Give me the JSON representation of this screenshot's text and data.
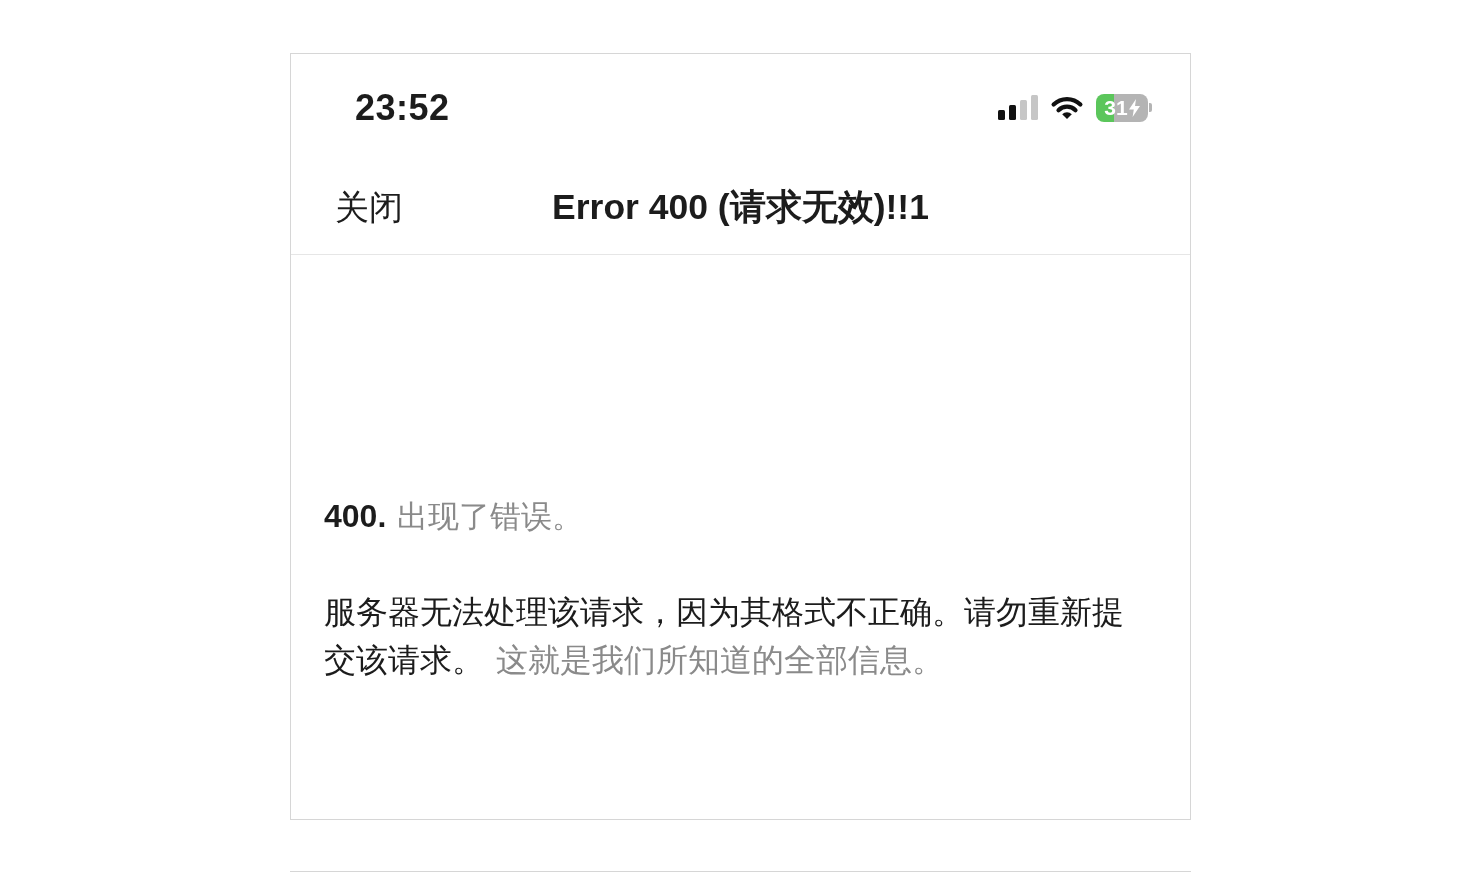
{
  "status_bar": {
    "time": "23:52",
    "battery_percent": "31",
    "charging": true
  },
  "nav_bar": {
    "close_label": "关闭",
    "title": "Error 400 (请求无效)!!1"
  },
  "error": {
    "code": "400.",
    "summary": "出现了错误。",
    "message": "服务器无法处理该请求，因为其格式不正确。请勿重新提交该请求。",
    "note": "这就是我们所知道的全部信息。"
  }
}
